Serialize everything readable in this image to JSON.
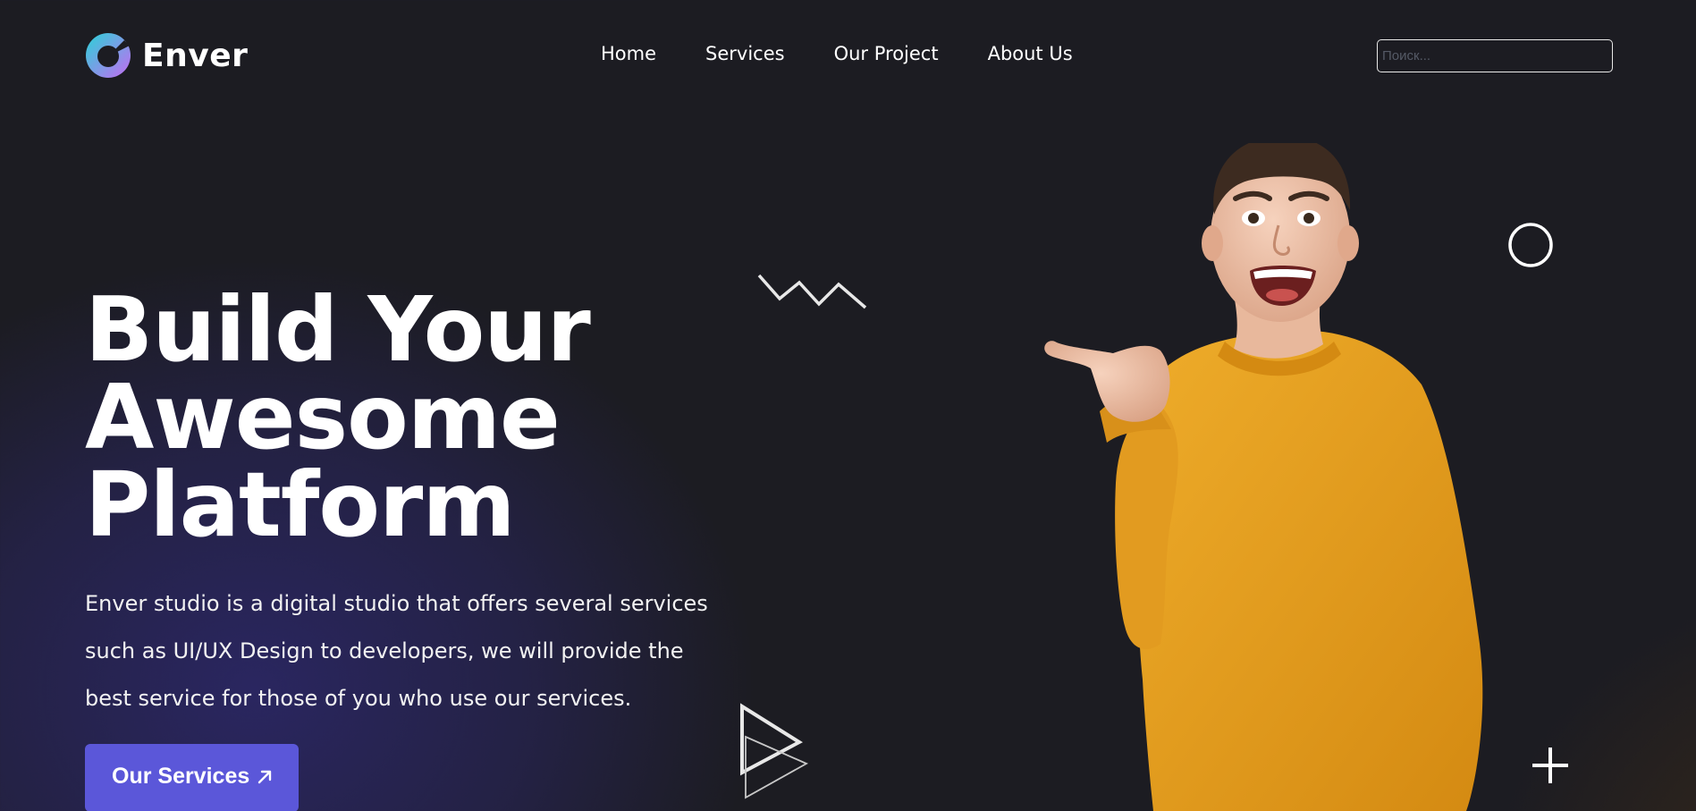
{
  "header": {
    "logo_text": "Enver",
    "nav": [
      {
        "label": "Home"
      },
      {
        "label": "Services"
      },
      {
        "label": "Our Project"
      },
      {
        "label": "About Us"
      }
    ],
    "search": {
      "placeholder": "Поиск...",
      "value": ""
    }
  },
  "hero": {
    "title_lines": [
      "Build Your",
      "Awesome",
      "Platform"
    ],
    "description": "Enver studio is a digital studio that offers several services such as UI/UX Design to developers, we will provide the best service for those of you who use our services.",
    "cta_label": "Our Services"
  },
  "colors": {
    "background": "#1c1c22",
    "accent": "#5b57d9",
    "sweater": "#e8a21e",
    "logo_gradient": [
      "#2ad3d8",
      "#c56bf2"
    ]
  },
  "icons": [
    "logo-icon",
    "arrow-up-right-icon",
    "zigzag-icon",
    "circle-icon",
    "play-triangle-icon",
    "plus-icon"
  ]
}
